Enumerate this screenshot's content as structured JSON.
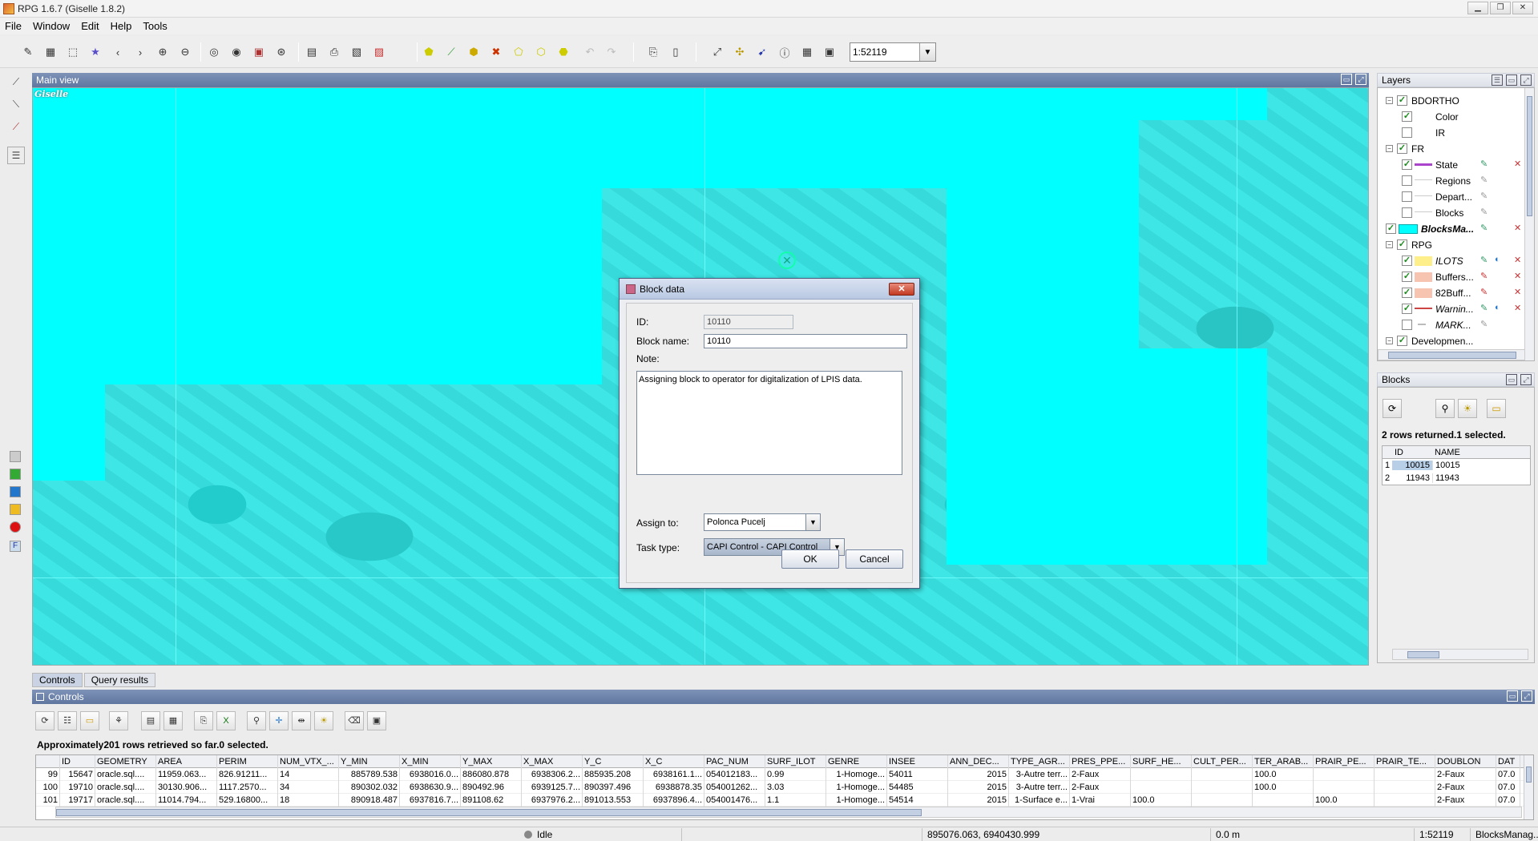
{
  "window": {
    "title": "RPG 1.6.7 (Giselle 1.8.2)"
  },
  "menu": [
    "File",
    "Window",
    "Edit",
    "Help",
    "Tools"
  ],
  "toolbar": {
    "scale_value": "1:52119"
  },
  "main_view": {
    "title": "Main view",
    "logo_text": "Giselle",
    "colors": {
      "overlay": "#00ffff",
      "base": "#34dede"
    }
  },
  "dialog": {
    "title": "Block data",
    "id_label": "ID:",
    "id_value": "10110",
    "block_name_label": "Block name:",
    "block_name_value": "10110",
    "note_label": "Note:",
    "note_value": "Assigning block to operator for digitalization of LPIS data.",
    "assign_label": "Assign to:",
    "assign_value": "Polonca Pucelj",
    "task_label": "Task type:",
    "task_value": "CAPI Control - CAPI Control",
    "ok_label": "OK",
    "cancel_label": "Cancel"
  },
  "layers": {
    "title": "Layers",
    "items": [
      {
        "label": "BDORTHO",
        "level": 0,
        "checked": true,
        "italic": false
      },
      {
        "label": "Color",
        "level": 1,
        "checked": true,
        "italic": false
      },
      {
        "label": "IR",
        "level": 1,
        "checked": false,
        "italic": false
      },
      {
        "label": "FR",
        "level": 0,
        "checked": true,
        "italic": false
      },
      {
        "label": "State",
        "level": 1,
        "checked": true,
        "italic": false
      },
      {
        "label": "Regions",
        "level": 1,
        "checked": false,
        "italic": false
      },
      {
        "label": "Depart...",
        "level": 1,
        "checked": false,
        "italic": false
      },
      {
        "label": "Blocks",
        "level": 1,
        "checked": false,
        "italic": false
      },
      {
        "label": "BlocksMa...",
        "level": 0,
        "checked": true,
        "italic": true
      },
      {
        "label": "RPG",
        "level": 0,
        "checked": true,
        "italic": false
      },
      {
        "label": "ILOTS",
        "level": 1,
        "checked": true,
        "italic": true
      },
      {
        "label": "Buffers...",
        "level": 1,
        "checked": true,
        "italic": false
      },
      {
        "label": "82Buff...",
        "level": 1,
        "checked": true,
        "italic": false
      },
      {
        "label": "Warnin...",
        "level": 1,
        "checked": true,
        "italic": true
      },
      {
        "label": "MARK...",
        "level": 1,
        "checked": false,
        "italic": true
      },
      {
        "label": "Developmen...",
        "level": 0,
        "checked": true,
        "italic": false
      }
    ]
  },
  "blocks_panel": {
    "title": "Blocks",
    "status": "2 rows returned.1 selected.",
    "columns": [
      "ID",
      "NAME"
    ],
    "rows": [
      {
        "n": "1",
        "id": "10015",
        "name": "10015"
      },
      {
        "n": "2",
        "id": "11943",
        "name": "11943"
      }
    ]
  },
  "bottom_tabs": [
    "Controls",
    "Query results"
  ],
  "controls": {
    "title": "Controls",
    "status": "Approximately201 rows retrieved so far.0 selected.",
    "columns": [
      "ID",
      "GEOMETRY",
      "AREA",
      "PERIM",
      "NUM_VTX_...",
      "Y_MIN",
      "X_MIN",
      "Y_MAX",
      "X_MAX",
      "Y_C",
      "X_C",
      "PAC_NUM",
      "SURF_ILOT",
      "GENRE",
      "INSEE",
      "ANN_DEC...",
      "TYPE_AGR...",
      "PRES_PPE...",
      "SURF_HE...",
      "CULT_PER...",
      "TER_ARAB...",
      "PRAIR_PE...",
      "PRAIR_TE...",
      "DOUBLON",
      "DAT"
    ],
    "rows": [
      [
        "99",
        "15647",
        "oracle.sql....",
        "11959.063...",
        "826.91211...",
        "14",
        "885789.538",
        "6938016.0...",
        "886080.878",
        "6938306.2...",
        "885935.208",
        "6938161.1...",
        "054012183...",
        "0.99",
        "1-Homoge...",
        "54011",
        "2015",
        "3-Autre terr...",
        "2-Faux",
        "",
        "",
        "100.0",
        "",
        "",
        "2-Faux",
        "07.0"
      ],
      [
        "100",
        "19710",
        "oracle.sql....",
        "30130.906...",
        "1117.2570...",
        "34",
        "890302.032",
        "6938630.9...",
        "890492.96",
        "6939125.7...",
        "890397.496",
        "6938878.35",
        "054001262...",
        "3.03",
        "1-Homoge...",
        "54485",
        "2015",
        "3-Autre terr...",
        "2-Faux",
        "",
        "",
        "100.0",
        "",
        "",
        "2-Faux",
        "07.0"
      ],
      [
        "101",
        "19717",
        "oracle.sql....",
        "11014.794...",
        "529.16800...",
        "18",
        "890918.487",
        "6937816.7...",
        "891108.62",
        "6937976.2...",
        "891013.553",
        "6937896.4...",
        "054001476...",
        "1.1",
        "1-Homoge...",
        "54514",
        "2015",
        "1-Surface e...",
        "1-Vrai",
        "100.0",
        "",
        "",
        "100.0",
        "",
        "2-Faux",
        "07.0"
      ]
    ]
  },
  "statusbar": {
    "state": "Idle",
    "coords": "895076.063, 6940430.999",
    "distance": "0.0 m",
    "scale": "1:52119",
    "layer": "BlocksManag..."
  }
}
